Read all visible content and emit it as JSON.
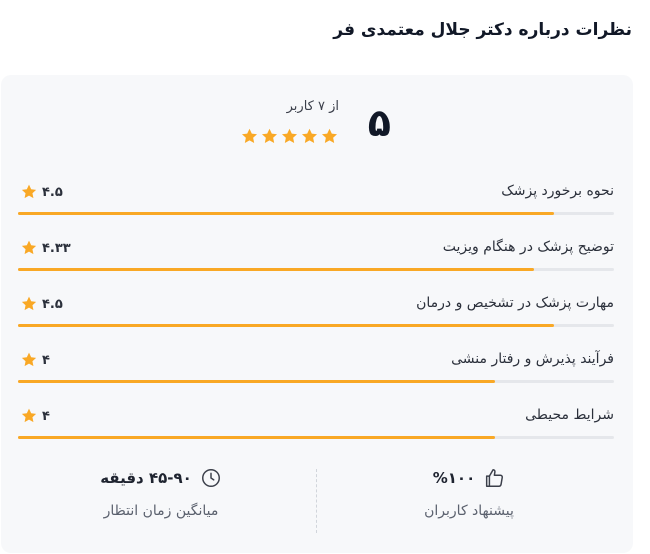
{
  "title": "نظرات درباره دکتر جلال معتمدی فر",
  "summary": {
    "score": "۵",
    "from_text": "از ۷ کاربر",
    "stars": 5
  },
  "ratings": [
    {
      "label": "نحوه برخورد پزشک",
      "value": "۴.۵",
      "fraction": 0.9
    },
    {
      "label": "توضیح پزشک در هنگام ویزیت",
      "value": "۴.۳۳",
      "fraction": 0.866
    },
    {
      "label": "مهارت پزشک در تشخیص و درمان",
      "value": "۴.۵",
      "fraction": 0.9
    },
    {
      "label": "فرآیند پذیرش و رفتار منشی",
      "value": "۴",
      "fraction": 0.8
    },
    {
      "label": "شرایط محیطی",
      "value": "۴",
      "fraction": 0.8
    }
  ],
  "stats": {
    "recommend": {
      "value": "%۱۰۰",
      "label": "پیشنهاد کاربران",
      "icon": "thumbs-up-icon"
    },
    "wait": {
      "value": "۴۵-۹۰ دقیقه",
      "label": "میانگین زمان انتظار",
      "icon": "clock-icon"
    }
  },
  "colors": {
    "accent": "#f9a825",
    "track": "#e5e7eb",
    "star": "#f9a825"
  }
}
